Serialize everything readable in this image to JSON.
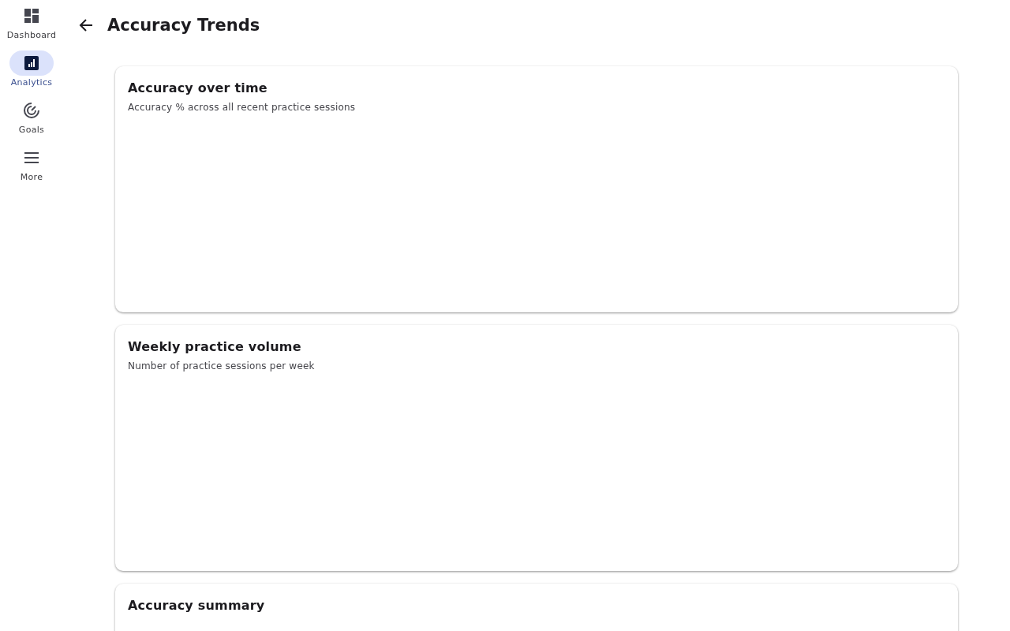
{
  "nav": [
    {
      "label": "Dashboard",
      "kind": "dashboard",
      "selected": false
    },
    {
      "label": "Analytics",
      "kind": "analytics",
      "selected": true
    },
    {
      "label": "Goals",
      "kind": "goals",
      "selected": false
    },
    {
      "label": "More",
      "kind": "more",
      "selected": false
    }
  ],
  "header": {
    "title": "Accuracy Trends"
  },
  "cards": [
    {
      "title": "Accuracy over time",
      "subtitle": "Accuracy % across all recent practice sessions"
    },
    {
      "title": "Weekly practice volume",
      "subtitle": "Number of practice sessions per week"
    },
    {
      "title": "Accuracy summary"
    }
  ]
}
